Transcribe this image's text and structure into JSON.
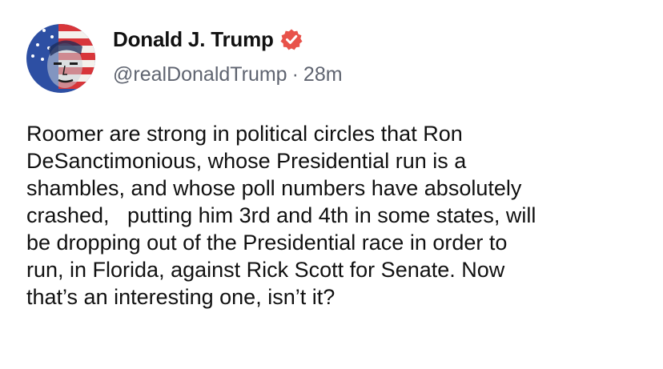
{
  "post": {
    "author": {
      "display_name": "Donald J. Trump",
      "handle": "@realDonaldTrump",
      "verified_icon": "verified-badge-icon",
      "verified_color": "#e8524a",
      "avatar": "avatar-image"
    },
    "separator": "·",
    "time": "28m",
    "body_lines": [
      "Roomer are strong in political circles that Ron",
      "DeSanctimonious, whose Presidential run is a",
      "shambles, and whose poll numbers have absolutely",
      "crashed,   putting him 3rd and 4th in some states, will",
      "be dropping out of the Presidential race in order to",
      "run, in Florida, against Rick Scott for Senate. Now",
      "that’s an interesting one, isn’t it?"
    ]
  }
}
